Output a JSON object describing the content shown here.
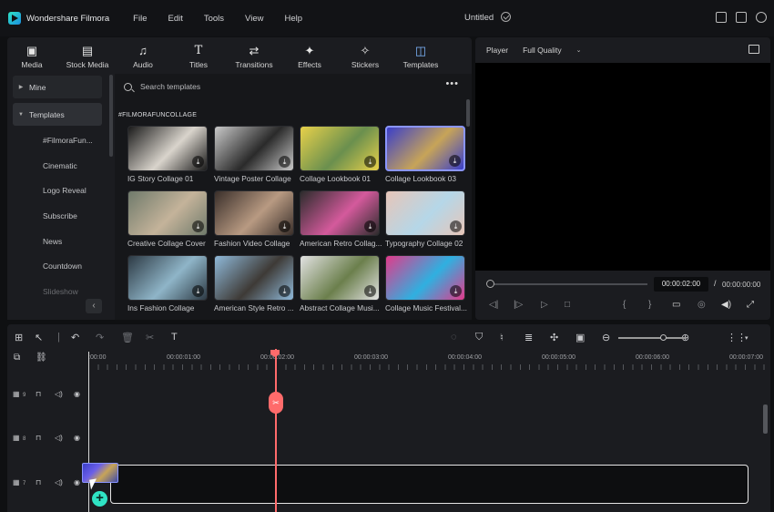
{
  "app": {
    "name": "Wondershare Filmora",
    "doc_title": "Untitled"
  },
  "menu": [
    "File",
    "Edit",
    "Tools",
    "View",
    "Help"
  ],
  "toolbar": [
    {
      "label": "Media",
      "icon": "media-icon",
      "glyph": "▣"
    },
    {
      "label": "Stock Media",
      "icon": "stock-media-icon",
      "glyph": "▤"
    },
    {
      "label": "Audio",
      "icon": "audio-icon",
      "glyph": "♫"
    },
    {
      "label": "Titles",
      "icon": "titles-icon",
      "glyph": "T"
    },
    {
      "label": "Transitions",
      "icon": "transitions-icon",
      "glyph": "⇄"
    },
    {
      "label": "Effects",
      "icon": "effects-icon",
      "glyph": "✦"
    },
    {
      "label": "Stickers",
      "icon": "stickers-icon",
      "glyph": "✧"
    },
    {
      "label": "Templates",
      "icon": "templates-icon",
      "glyph": "◫"
    }
  ],
  "sidebar": {
    "mine": "Mine",
    "templates": "Templates",
    "subitems": [
      "#FilmoraFun...",
      "Cinematic",
      "Logo Reveal",
      "Subscribe",
      "News",
      "Countdown",
      "Slideshow"
    ]
  },
  "search": {
    "placeholder": "Search templates"
  },
  "section_title": "#FILMORAFUNCOLLAGE",
  "templates": [
    {
      "name": "IG Story Collage 01",
      "colors": [
        "#1a1a1a",
        "#d9d4cc"
      ]
    },
    {
      "name": "Vintage Poster Collage",
      "colors": [
        "#c9c9c9",
        "#2a2a2a"
      ]
    },
    {
      "name": "Collage Lookbook 01",
      "colors": [
        "#e8d14a",
        "#6a8f4e"
      ]
    },
    {
      "name": "Collage Lookbook 03",
      "colors": [
        "#3b3fc9",
        "#c7a458"
      ],
      "selected": true
    },
    {
      "name": "Creative Collage Cover",
      "colors": [
        "#6f7a6b",
        "#c4b39a"
      ]
    },
    {
      "name": "Fashion Video Collage",
      "colors": [
        "#3a2f2a",
        "#b89a82"
      ]
    },
    {
      "name": "American Retro Collag...",
      "colors": [
        "#2c2c2c",
        "#d45a9c"
      ]
    },
    {
      "name": "Typography Collage 02",
      "colors": [
        "#e7c5b8",
        "#b5d7e8"
      ]
    },
    {
      "name": "Ins Fashion Collage",
      "colors": [
        "#2d3a44",
        "#8fb5c8"
      ]
    },
    {
      "name": "American Style Retro ...",
      "colors": [
        "#8fb9d9",
        "#3e3a36"
      ]
    },
    {
      "name": "Abstract Collage Musi...",
      "colors": [
        "#e2e2e2",
        "#6b7f4c"
      ]
    },
    {
      "name": "Collage Music Festival...",
      "colors": [
        "#e23a8a",
        "#2fb0e0"
      ]
    }
  ],
  "player": {
    "label": "Player",
    "quality": "Full Quality",
    "current_time": "00:00:02:00",
    "separator": "/",
    "total_time": "00:00:00:00"
  },
  "timeline": {
    "ruler": [
      ":00:00",
      "00:00:01:00",
      "00:00:02:00",
      "00:00:03:00",
      "00:00:04:00",
      "00:00:05:00",
      "00:00:06:00",
      "00:00:07:00"
    ],
    "tracks": [
      "9",
      "8",
      "7"
    ]
  },
  "colors": {
    "accent": "#2fe3c4",
    "playhead": "#ff6b6b",
    "selection": "#8a95ff"
  }
}
